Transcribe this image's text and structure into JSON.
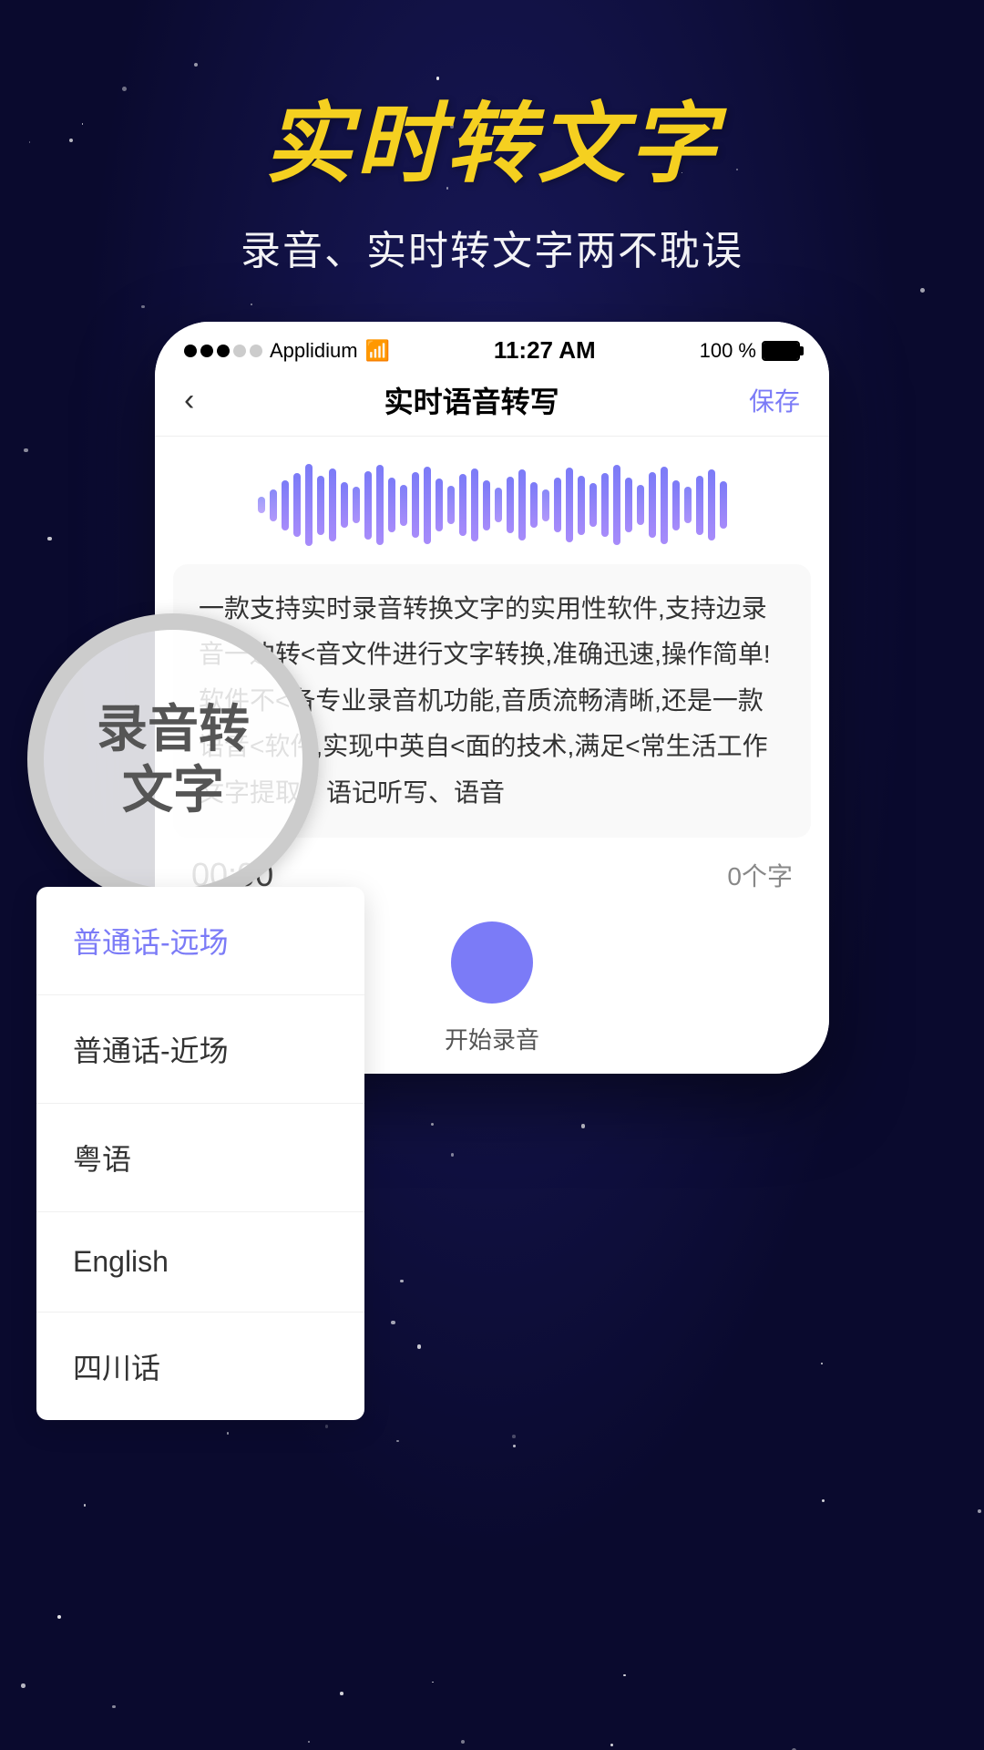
{
  "background": {
    "color_top": "#0a0a2e",
    "color_mid": "#1a1a5e"
  },
  "top_section": {
    "main_title": "实时转文字",
    "sub_title": "录音、实时转文字两不耽误"
  },
  "status_bar": {
    "carrier": "Applidium",
    "time": "11:27 AM",
    "battery": "100 %"
  },
  "nav": {
    "back_label": "‹",
    "title": "实时语音转写",
    "save_label": "保存"
  },
  "content": {
    "text": "一款支持实时录音转换文字的实用性软件,支持边录音一边转<音文件进行文字转换,准确迅速,操作简单!软件不<备专业录音机功能,音质流畅清晰,还是一款语音<软件,实现中英自<面的技术,满足<常生活工作文字提取、语记听写、语音"
  },
  "timer": {
    "time": "00:00",
    "word_count": "0个字"
  },
  "record": {
    "start_label": "开始录音"
  },
  "magnifier": {
    "text": "录音转\n文字"
  },
  "dropdown": {
    "items": [
      {
        "label": "普通话-远场",
        "active": true
      },
      {
        "label": "普通话-近场",
        "active": false
      },
      {
        "label": "粤语",
        "active": false
      },
      {
        "label": "English",
        "active": false
      },
      {
        "label": "四川话",
        "active": false
      }
    ]
  },
  "waveform": {
    "bars": [
      18,
      35,
      55,
      70,
      90,
      65,
      80,
      50,
      40,
      75,
      88,
      60,
      45,
      72,
      85,
      58,
      42,
      68,
      80,
      55,
      38,
      62,
      78,
      50,
      35,
      60,
      82,
      65,
      48,
      70,
      88,
      60,
      44,
      72,
      85,
      55,
      40,
      65,
      78,
      52
    ]
  }
}
